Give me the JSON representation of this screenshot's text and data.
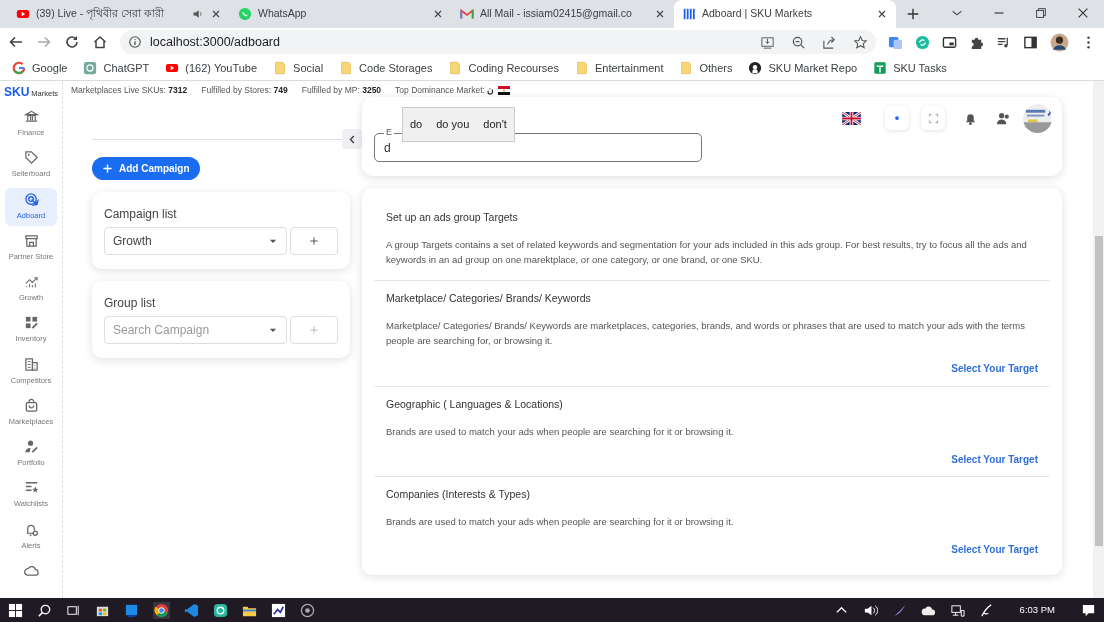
{
  "browser": {
    "tabs": [
      {
        "kind": "youtube",
        "title": "(39) Live - পৃথিবীর সেরা কারী",
        "audio": true,
        "selected": false
      },
      {
        "kind": "whatsapp",
        "title": "WhatsApp",
        "audio": false,
        "selected": false
      },
      {
        "kind": "gmail",
        "title": "All Mail - issiam02415@gmail.co",
        "audio": false,
        "selected": false
      },
      {
        "kind": "bars",
        "title": "Adboard | SKU Markets",
        "audio": false,
        "selected": true
      }
    ],
    "address": "localhost:3000/adboard",
    "bookmarks": [
      {
        "kind": "google",
        "label": "Google"
      },
      {
        "kind": "chatgpt",
        "label": "ChatGPT"
      },
      {
        "kind": "youtube",
        "label": "(162) YouTube"
      },
      {
        "kind": "folder",
        "label": "Social"
      },
      {
        "kind": "folder",
        "label": "Code Storages"
      },
      {
        "kind": "folder",
        "label": "Coding Recourses"
      },
      {
        "kind": "folder",
        "label": "Entertainment"
      },
      {
        "kind": "folder",
        "label": "Others"
      },
      {
        "kind": "github",
        "label": "SKU Market Repo"
      },
      {
        "kind": "sheets",
        "label": "SKU Tasks"
      }
    ]
  },
  "app": {
    "logo": {
      "brand": "SKU",
      "suffix": "Markets"
    },
    "stats": [
      {
        "label": "Marketplaces Live SKUs:",
        "value": "7312"
      },
      {
        "label": "Fulfilled by Stores:",
        "value": "749"
      },
      {
        "label": "Fulfilled by MP:",
        "value": "3250"
      },
      {
        "label": "Top Dominance Market:",
        "value": "ن"
      }
    ],
    "sidebar": [
      {
        "kind": "bank",
        "label": "Finance",
        "selected": false
      },
      {
        "kind": "tag",
        "label": "Sellerboard",
        "selected": false
      },
      {
        "kind": "target",
        "label": "Adboard",
        "selected": true
      },
      {
        "kind": "store",
        "label": "Partner Store",
        "selected": false
      },
      {
        "kind": "growth",
        "label": "Growth",
        "selected": false
      },
      {
        "kind": "grid",
        "label": "Inventory",
        "selected": false
      },
      {
        "kind": "building",
        "label": "Competitors",
        "selected": false
      },
      {
        "kind": "bag",
        "label": "Marketplaces",
        "selected": false
      },
      {
        "kind": "person",
        "label": "Portfolio",
        "selected": false
      },
      {
        "kind": "liststar",
        "label": "Watchlists",
        "selected": false
      },
      {
        "kind": "bellgear",
        "label": "Alerts",
        "selected": false
      },
      {
        "kind": "cloud",
        "selected": false
      }
    ],
    "add_button": "Add Campaign",
    "campaign_list": {
      "label": "Campaign list",
      "value": "Growth",
      "disabled": false
    },
    "group_list": {
      "label": "Group list",
      "placeholder": "Search Campaign",
      "disabled": true
    },
    "search_card": {
      "label": "E",
      "value": "d",
      "suggestions": [
        "do",
        "do you",
        "don't"
      ]
    },
    "targets_card": {
      "title": "Set up an ads group Targets",
      "description": "A group Targets contains a set of related keywords and segmentation for your ads included in this ads group. For best results, try to focus all the ads and keywords in an ad group on one marektplace, or one category, or one brand, or one SKU.",
      "sections": [
        {
          "title": "Marketplace/ Categories/ Brands/ Keywords",
          "description": "Marketplace/ Categories/ Brands/ Keywords are marketplaces, categories, brands, and words or phrases that are used to match your ads with the terms people are searching for, or browsing it.",
          "link": "Select Your Target"
        },
        {
          "title": "Geographic ( Languages & Locations)",
          "description": "Brands are used to match your ads when people are searching for it or browsing it.",
          "link": "Select Your Target"
        },
        {
          "title": "Companies (Interests & Types)",
          "description": "Brands are used to match your ads when people are searching for it or browsing it.",
          "link": "Select Your Target"
        }
      ]
    }
  },
  "taskbar": {
    "time": "6:03 PM"
  }
}
